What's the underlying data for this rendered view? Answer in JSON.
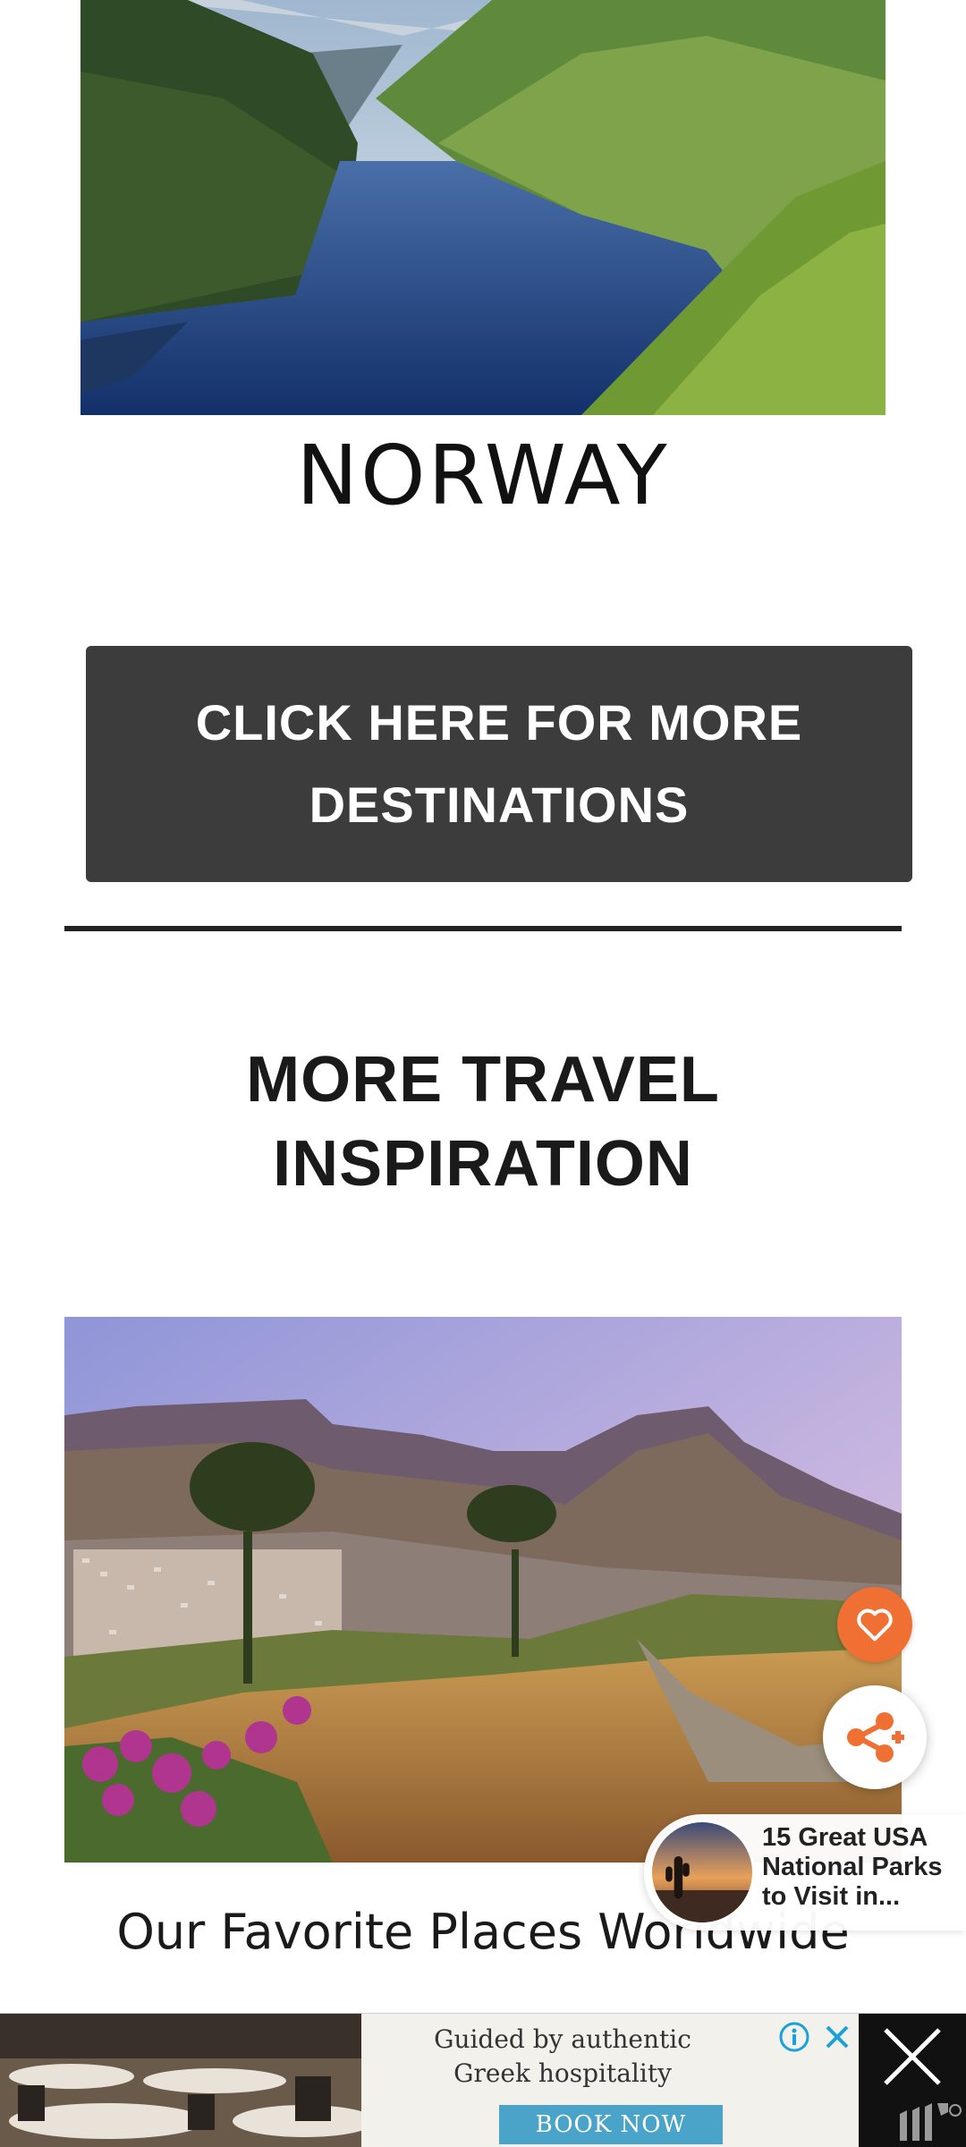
{
  "norway": {
    "caption": "NORWAY"
  },
  "cta": {
    "label": "CLICK HERE FOR MORE DESTINATIONS"
  },
  "section": {
    "heading": "MORE TRAVEL INSPIRATION"
  },
  "card": {
    "caption": "Our Favorite Places Worldwide"
  },
  "floating": {
    "favorite_icon": "heart-icon",
    "share_icon": "share-icon",
    "accent_color": "#f07034"
  },
  "recommendation": {
    "title": "15 Great USA National Parks to Visit in..."
  },
  "ad": {
    "headline": "Guided by authentic Greek hospitality",
    "cta_label": "BOOK NOW",
    "info_icon": "info-icon",
    "dismiss_icon": "close-icon",
    "cta_color": "#4aa3c8"
  }
}
